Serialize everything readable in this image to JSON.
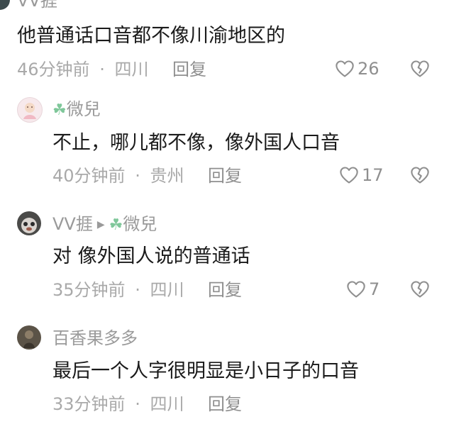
{
  "comments": [
    {
      "user": "VV捱",
      "text": "他普通话口音都不像川渝地区的",
      "time": "46分钟前",
      "location": "四川",
      "reply_label": "回复",
      "likes": "26"
    },
    {
      "user": "微兒",
      "text": "不止，哪儿都不像，像外国人口音",
      "time": "40分钟前",
      "location": "贵州",
      "reply_label": "回复",
      "likes": "17"
    },
    {
      "user": "VV捱",
      "reply_to": "微兒",
      "text": "对 像外国人说的普通话",
      "time": "35分钟前",
      "location": "四川",
      "reply_label": "回复",
      "likes": "7"
    },
    {
      "user": "百香果多多",
      "text": "最后一个人字很明显是小日子的口音",
      "time": "33分钟前",
      "location": "四川",
      "reply_label": "回复"
    }
  ],
  "separator": "·",
  "icons": {
    "like": "heart-outline-icon",
    "dislike": "broken-heart-icon",
    "clover": "clover-icon",
    "reply_arrow": "right-triangle-icon"
  },
  "colors": {
    "text": "#1a1a1a",
    "meta": "#a9a9a9",
    "name": "#9a9a9a",
    "clover": "#7fc79a"
  }
}
